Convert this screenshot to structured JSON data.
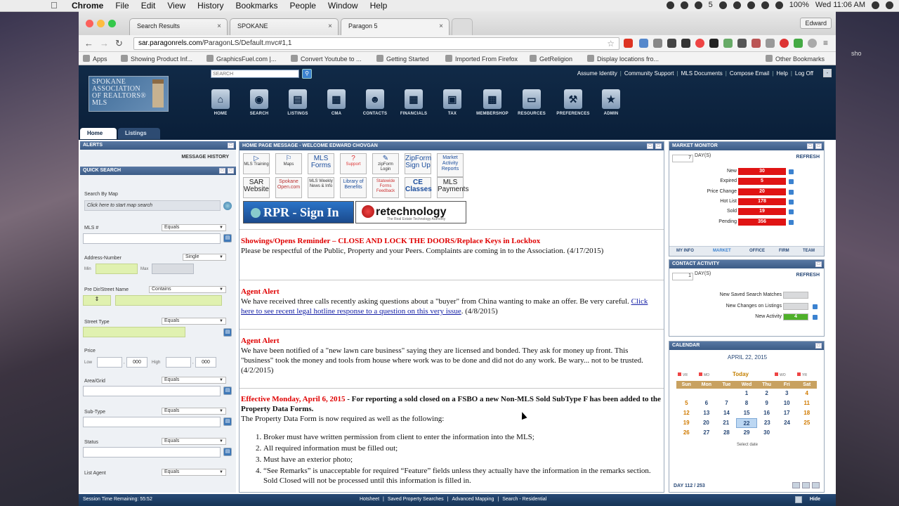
{
  "menubar": {
    "app": "Chrome",
    "items": [
      "File",
      "Edit",
      "View",
      "History",
      "Bookmarks",
      "People",
      "Window",
      "Help"
    ],
    "battery": "100%",
    "clock": "Wed 11:06 AM",
    "badge": "5"
  },
  "browser": {
    "tabs": [
      "Search Results",
      "SPOKANE",
      "Paragon 5"
    ],
    "user": "Edward",
    "url_host": "sar.paragonrels.com",
    "url_path": "/ParagonLS/Default.mvc#1,1",
    "bookmarks": [
      "Apps",
      "Showing Product Inf...",
      "GraphicsFuel.com |...",
      "Convert Youtube to ...",
      "Getting Started",
      "Imported From Firefox",
      "GetReligion",
      "Display locations fro...",
      "Other Bookmarks"
    ]
  },
  "header": {
    "logo_lines": [
      "SPOKANE",
      "ASSOCIATION",
      "OF REALTORS®",
      "MLS"
    ],
    "search_placeholder": "SEARCH",
    "top_links": [
      "Assume Identity",
      "Community Support",
      "MLS Documents",
      "Compose Email",
      "Help",
      "Log Off"
    ],
    "nav": [
      {
        "label": "HOME",
        "icon": "home-icon"
      },
      {
        "label": "SEARCH",
        "icon": "binoculars-icon"
      },
      {
        "label": "LISTINGS",
        "icon": "listings-icon"
      },
      {
        "label": "CMA",
        "icon": "cma-icon"
      },
      {
        "label": "CONTACTS",
        "icon": "contacts-icon"
      },
      {
        "label": "FINANCIALS",
        "icon": "calculator-icon"
      },
      {
        "label": "TAX",
        "icon": "tax-icon"
      },
      {
        "label": "MEMBERSHOP",
        "icon": "briefcase-icon"
      },
      {
        "label": "RESOURCES",
        "icon": "folder-icon"
      },
      {
        "label": "PREFERENCES",
        "icon": "wrench-icon"
      },
      {
        "label": "ADMIN",
        "icon": "badge-icon"
      }
    ],
    "page_tabs": [
      "Home",
      "Listings"
    ]
  },
  "left": {
    "alerts_title": "ALERTS",
    "message_history": "MESSAGE HISTORY",
    "qs_title": "QUICK SEARCH",
    "search_by_map": "Search By Map",
    "map_placeholder": "Click here to start map search",
    "fields": {
      "mls": {
        "label": "MLS #",
        "op": "Equals"
      },
      "address_number": {
        "label": "Address-Number",
        "op": "Single",
        "min": "Min",
        "max": "Max"
      },
      "street_name": {
        "label": "Pre Dir/Street Name",
        "op": "Contains"
      },
      "street_type": {
        "label": "Street Type",
        "op": "Equals"
      },
      "price": {
        "label": "Price",
        "low": "Low",
        "high": "High",
        "suffix": "000"
      },
      "area_grid": {
        "label": "Area/Grid",
        "op": "Equals"
      },
      "sub_type": {
        "label": "Sub-Type",
        "op": "Equals"
      },
      "status": {
        "label": "Status",
        "op": "Equals"
      },
      "list_agent": {
        "label": "List Agent",
        "op": "Equals"
      }
    }
  },
  "middle": {
    "title": "HOME PAGE MESSAGE - WELCOME EDWARD CHOVGAN",
    "icon_buttons": [
      [
        "MLS Training",
        "Maps",
        "MLS Forms",
        "Support",
        "zipForm Login",
        "ZipForm Sign Up",
        "Market Activity Reports"
      ],
      [
        "SAR Website",
        "Spokane Open.com",
        "MLS Weekly News & Info",
        "Library of Benefits",
        "Statewide Forms Feedback",
        "CE Classes",
        "MLS Payments"
      ]
    ],
    "rpr": "RPR - Sign In",
    "retech": "retechnology",
    "retech_sub": "The Real Estate Technology Authority",
    "messages": [
      {
        "title": "Showings/Opens Reminder – CLOSE AND LOCK THE DOORS/Replace Keys in Lockbox",
        "body": "Please be respectful of the Public, Property and your Peers. Complaints are coming in to the Association. (4/17/2015)"
      },
      {
        "title": "Agent Alert",
        "body": "We have received three calls recently asking questions about a \"buyer\" from China wanting to make an offer. Be very careful. ",
        "link": "Click here to see recent legal hotline response to a question on this very issue",
        "tail": ". (4/8/2015)"
      },
      {
        "title": "Agent Alert",
        "body": "We have been notified of a \"new lawn care business\" saying they are licensed and bonded. They ask for money up front. This \"business\" took the money and tools from house where work was to be done and did not do any work. Be wary... not to be trusted. (4/2/2015)"
      },
      {
        "title": "Effective Monday, April 6, 2015",
        "bold": " - For reporting a sold closed on a FSBO a new Non-MLS Sold SubType F has been added to the Property Data Forms.",
        "body": "The Property Data Form is now required as well as the following:",
        "list": [
          "Broker must have written permission from client to enter the information into the MLS;",
          "All required information must be filled out;",
          "Must have an exterior photo;",
          "“See Remarks” is unacceptable for required “Feature” fields unless they actually have the information in the remarks section. Sold Closed will not be processed until this information is filled in."
        ]
      }
    ]
  },
  "right": {
    "mm_title": "MARKET MONITOR",
    "mm_days": "7",
    "days_label": "DAY(S)",
    "refresh": "REFRESH",
    "mm_rows": [
      {
        "label": "New",
        "value": "30"
      },
      {
        "label": "Expired",
        "value": "5"
      },
      {
        "label": "Price Change",
        "value": "20"
      },
      {
        "label": "Hot List",
        "value": "178"
      },
      {
        "label": "Sold",
        "value": "19"
      },
      {
        "label": "Pending",
        "value": "356"
      }
    ],
    "mm_tabs": [
      "MY INFO",
      "MARKET",
      "OFFICE",
      "FIRM",
      "TEAM"
    ],
    "ca_title": "CONTACT ACTIVITY",
    "ca_days": "1",
    "ca_rows": [
      {
        "label": "New Saved Search Matches",
        "value": ""
      },
      {
        "label": "New Changes on Listings",
        "value": ""
      },
      {
        "label": "New Activity",
        "value": "4"
      }
    ],
    "cal_title": "CALENDAR",
    "cal_month": "APRIL 22, 2015",
    "cal_today": "Today",
    "cal_legend": [
      "VR",
      "MO",
      "WO",
      "YR"
    ],
    "cal_days": [
      "Sun",
      "Mon",
      "Tue",
      "Wed",
      "Thu",
      "Fri",
      "Sat"
    ],
    "cal_weeks": [
      [
        "",
        "",
        "",
        "1",
        "2",
        "3",
        "4"
      ],
      [
        "5",
        "6",
        "7",
        "8",
        "9",
        "10",
        "11"
      ],
      [
        "12",
        "13",
        "14",
        "15",
        "16",
        "17",
        "18"
      ],
      [
        "19",
        "20",
        "21",
        "22",
        "23",
        "24",
        "25"
      ],
      [
        "26",
        "27",
        "28",
        "29",
        "30",
        "",
        ""
      ]
    ],
    "cal_select": "Select date",
    "cal_daycount": "DAY 112 / 253"
  },
  "footer": {
    "session": "Session Time Remaining: 55:52",
    "links": [
      "Hotsheet",
      "Saved Property Searches",
      "Advanced Mapping",
      "Search - Residential"
    ],
    "hide": "Hide"
  },
  "colors": {
    "header_bg": "#0b2340",
    "panel_header": "#4a6a96",
    "mm_bar": "#e01414",
    "ca_green": "#4fb12a",
    "cal_header": "#c8a160"
  }
}
